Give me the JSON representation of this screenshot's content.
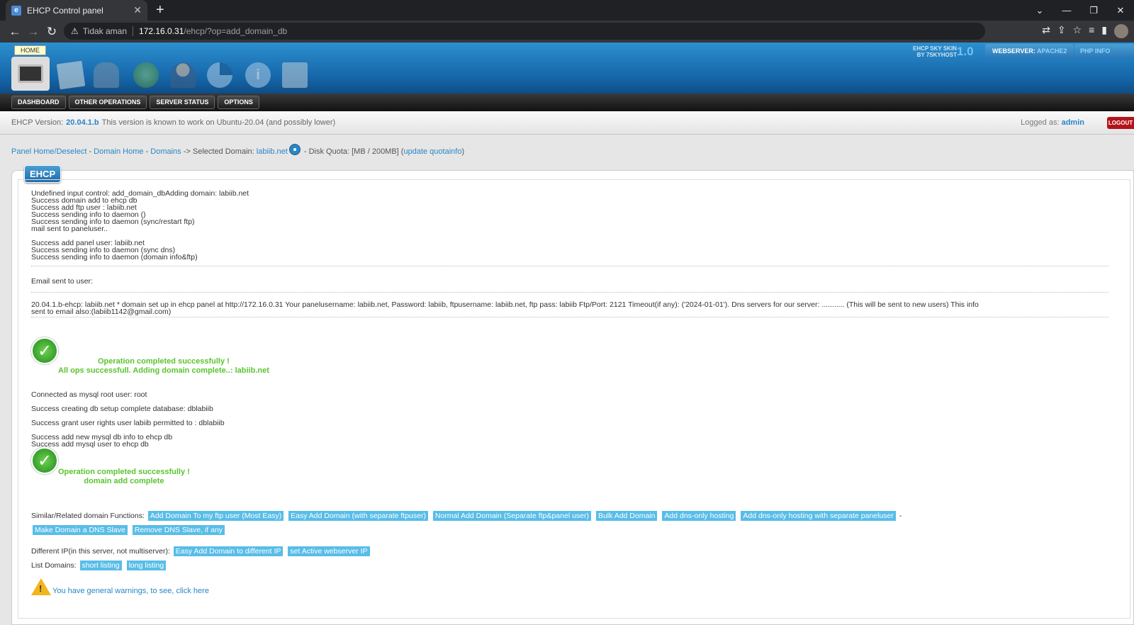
{
  "browser": {
    "tab_title": "EHCP Control panel",
    "not_secure": "Tidak aman",
    "url_host": "172.16.0.31",
    "url_path": "/ehcp/?op=add_domain_db"
  },
  "header": {
    "home_label": "HOME",
    "skin_line1": "EHCP SKY SKIN",
    "skin_line2": "BY 7SKYHOST",
    "skin_version": "1.0",
    "webserver_label": "WEBSERVER:",
    "webserver_value": "APACHE2",
    "php_info": "PHP INFO"
  },
  "menu": {
    "items": [
      "DASHBOARD",
      "OTHER OPERATIONS",
      "SERVER STATUS",
      "OPTIONS"
    ]
  },
  "version_bar": {
    "label": "EHCP Version:",
    "version": "20.04.1.b",
    "note": "This version is known to work on Ubuntu-20.04 (and possibly lower)",
    "logged_label": "Logged as:",
    "user": "admin",
    "logout": "LOGOUT"
  },
  "breadcrumb": {
    "panel_home": "Panel Home/Deselect",
    "sep1": " - ",
    "domain_home": "Domain Home",
    "sep2": " - ",
    "domains": "Domains",
    "selected": " -> Selected Domain: ",
    "domain": "labiib.net",
    "quota": " - Disk Quota: [MB / 200MB] (",
    "update": "update quotainfo",
    "close": ")"
  },
  "main": {
    "badge": "EHCP",
    "log1": [
      "Undefined input control: add_domain_dbAdding domain: labiib.net",
      "Success domain add to ehcp db",
      "Success add ftp user : labiib.net",
      "Success sending info to daemon ()",
      "Success sending info to daemon (sync/restart ftp)",
      "mail sent to paneluser..",
      "",
      "Success add panel user: labiib.net",
      "Success sending info to daemon (sync dns)",
      "Success sending info to daemon (domain info&ftp)"
    ],
    "email_sent": "Email sent to user:",
    "email_body1": "20.04.1.b-ehcp: labiib.net * domain set up in ehcp panel at http://172.16.0.31 Your panelusername: labiib.net, Password: labiib, ftpusername: labiib.net, ftp pass: labiib Ftp/Port: 2121 Timeout(if any): ('2024-01-01'). Dns servers for our server: ........... (This will be sent to new users) This info",
    "email_body2": "sent to email also:(labiib1142@gmail.com)",
    "ok1_line1": "Operation completed successfully !",
    "ok1_line2": "All ops successfull. Adding domain complete..: labiib.net",
    "mysql1": "Connected as mysql root user: root",
    "mysql2": "Success creating db setup complete database: dblabiib",
    "mysql3": "Success grant user rights user labiib permitted to : dblabiib",
    "mysql4": "Success add new mysql db info to ehcp db",
    "mysql5": "Success add mysql user to ehcp db",
    "ok2_line1": "Operation completed successfully !",
    "ok2_line2": "domain add complete",
    "similar_label": "Similar/Related domain Functions:",
    "similar_links": [
      "Add Domain To my ftp user (Most Easy)",
      "Easy Add Domain (with separate ftpuser)",
      "Normal Add Domain (Separate ftp&panel user)",
      "Bulk Add Domain",
      "Add dns-only hosting",
      "Add dns-only hosting with separate paneluser"
    ],
    "similar_dash": "-",
    "similar_links2": [
      "Make Domain a DNS Slave",
      "Remove DNS Slave, if any"
    ],
    "diffip_label": "Different IP(in this server, not multiserver):",
    "diffip_links": [
      "Easy Add Domain to different IP",
      "set Active webserver IP"
    ],
    "list_label": "List Domains:",
    "list_links": [
      "short listing",
      "long listing"
    ],
    "warning_link": "You have general warnings, to see, click here"
  },
  "colors": {
    "link": "#2a86c4",
    "highlight": "#58bde8",
    "success": "#5ac42f",
    "logout": "#b3131a"
  }
}
